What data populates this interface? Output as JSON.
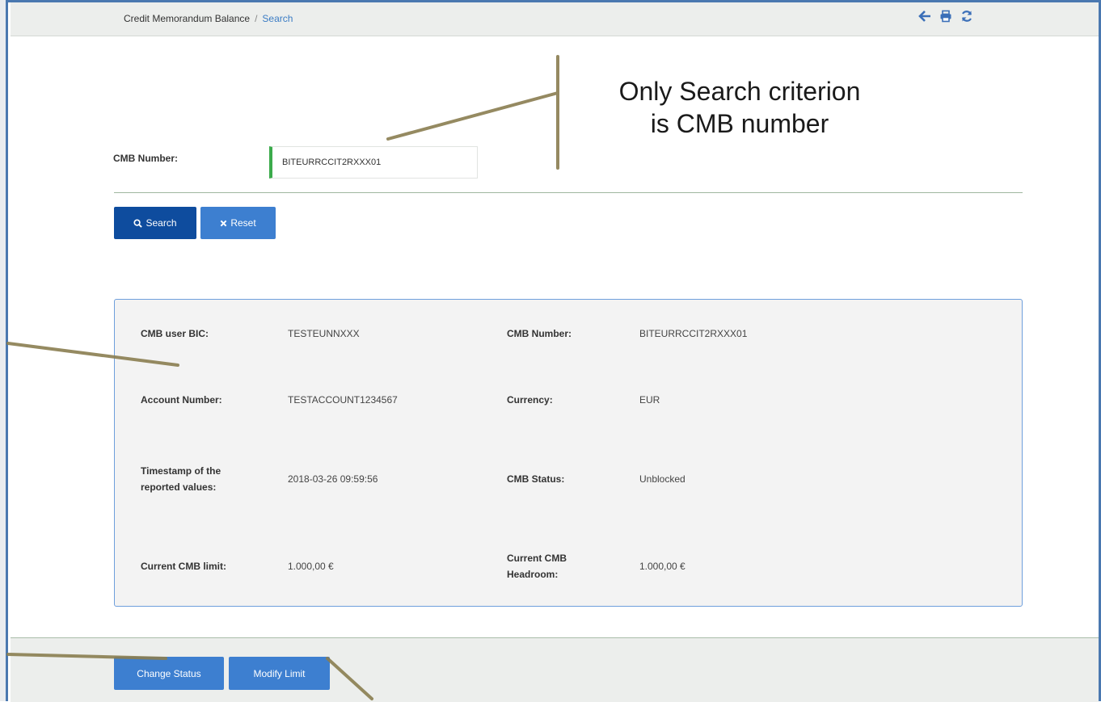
{
  "breadcrumb": {
    "root": "Credit Memorandum Balance",
    "separator": "/",
    "current": "Search"
  },
  "toolbar_icons": [
    "back-arrow-icon",
    "print-icon",
    "refresh-icon"
  ],
  "search_form": {
    "cmb_number_label": "CMB Number:",
    "cmb_number_value": "BITEURRCCIT2RXXX01"
  },
  "buttons": {
    "search": "Search",
    "reset": "Reset",
    "change_status": "Change Status",
    "modify_limit": "Modify Limit"
  },
  "details": {
    "cmb_user_bic_label": "CMB user BIC:",
    "cmb_user_bic_value": "TESTEUNNXXX",
    "cmb_number_label": "CMB Number:",
    "cmb_number_value": "BITEURRCCIT2RXXX01",
    "account_number_label": "Account Number:",
    "account_number_value": "TESTACCOUNT1234567",
    "currency_label": "Currency:",
    "currency_value": "EUR",
    "timestamp_label_line1": "Timestamp of the",
    "timestamp_label_line2": "reported values:",
    "timestamp_value": "2018-03-26 09:59:56",
    "cmb_status_label": "CMB Status:",
    "cmb_status_value": "Unblocked",
    "current_limit_label": "Current CMB limit:",
    "current_limit_value": "1.000,00 €",
    "current_headroom_label_line1": "Current CMB",
    "current_headroom_label_line2": "Headroom:",
    "current_headroom_value": "1.000,00 €"
  },
  "callout": {
    "line1": "Only Search criterion",
    "line2": "is CMB number"
  },
  "colors": {
    "primary_dark": "#0e4c9e",
    "primary": "#3d7fd0",
    "valid_green": "#3cab4c",
    "pointer": "#8a7d50"
  }
}
